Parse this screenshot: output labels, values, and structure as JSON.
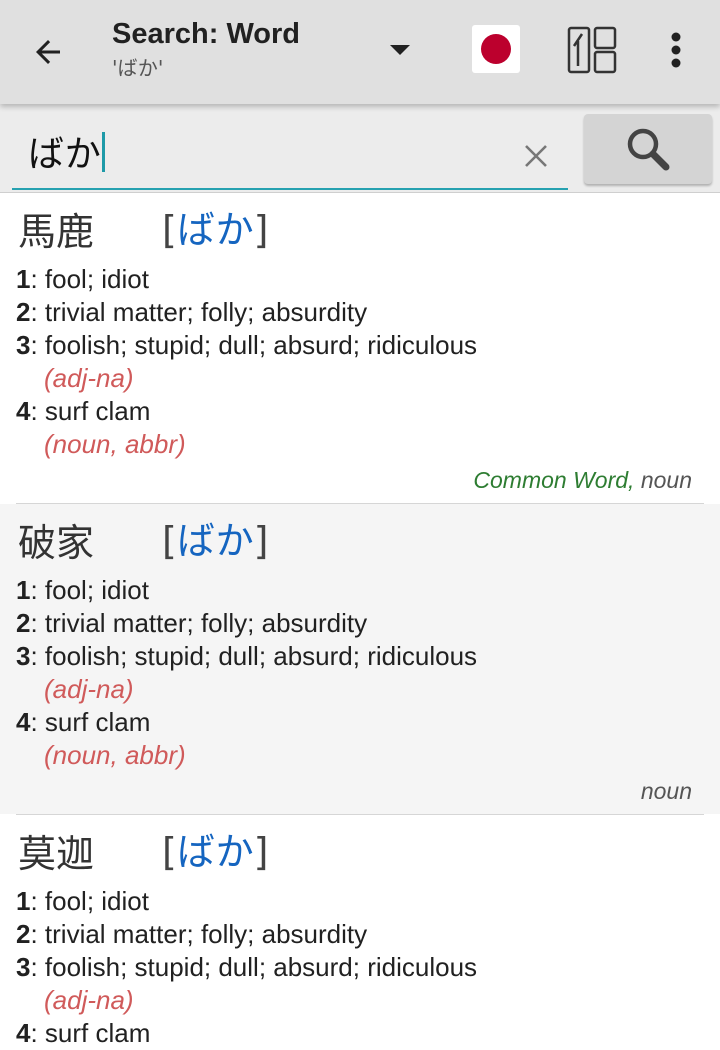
{
  "header": {
    "title": "Search: Word",
    "subtitle": "'ばか'",
    "back_icon": "arrow-back-icon",
    "dropdown_icon": "dropdown-triangle-icon",
    "flag_icon": "japan-flag-icon",
    "layout_icon": "kanji-layout-icon",
    "overflow_icon": "more-vert-icon",
    "flag_color": "#bc002d"
  },
  "search": {
    "query": "ばか",
    "clear_icon": "close-icon",
    "search_icon": "search-icon",
    "accent_color": "#26a1b0"
  },
  "entries": [
    {
      "kanji": "馬鹿",
      "bracket_open": "[",
      "reading": "ばか",
      "bracket_close": "]",
      "senses": [
        {
          "num": "1",
          "text": ": fool; idiot",
          "pos": ""
        },
        {
          "num": "2",
          "text": ": trivial matter; folly; absurdity",
          "pos": ""
        },
        {
          "num": "3",
          "text": ": foolish; stupid; dull; absurd; ridiculous",
          "pos": "(adj-na)"
        },
        {
          "num": "4",
          "text": ": surf clam",
          "pos": "(noun, abbr)"
        }
      ],
      "common": "Common Word,",
      "type": " noun"
    },
    {
      "kanji": "破家",
      "bracket_open": "[",
      "reading": "ばか",
      "bracket_close": "]",
      "senses": [
        {
          "num": "1",
          "text": ": fool; idiot",
          "pos": ""
        },
        {
          "num": "2",
          "text": ": trivial matter; folly; absurdity",
          "pos": ""
        },
        {
          "num": "3",
          "text": ": foolish; stupid; dull; absurd; ridiculous",
          "pos": "(adj-na)"
        },
        {
          "num": "4",
          "text": ": surf clam",
          "pos": "(noun, abbr)"
        }
      ],
      "common": "",
      "type": "noun"
    },
    {
      "kanji": "莫迦",
      "bracket_open": "[",
      "reading": "ばか",
      "bracket_close": "]",
      "senses": [
        {
          "num": "1",
          "text": ": fool; idiot",
          "pos": ""
        },
        {
          "num": "2",
          "text": ": trivial matter; folly; absurdity",
          "pos": ""
        },
        {
          "num": "3",
          "text": ": foolish; stupid; dull; absurd; ridiculous",
          "pos": "(adj-na)"
        },
        {
          "num": "4",
          "text": ": surf clam",
          "pos": ""
        }
      ],
      "common": "",
      "type": ""
    }
  ]
}
